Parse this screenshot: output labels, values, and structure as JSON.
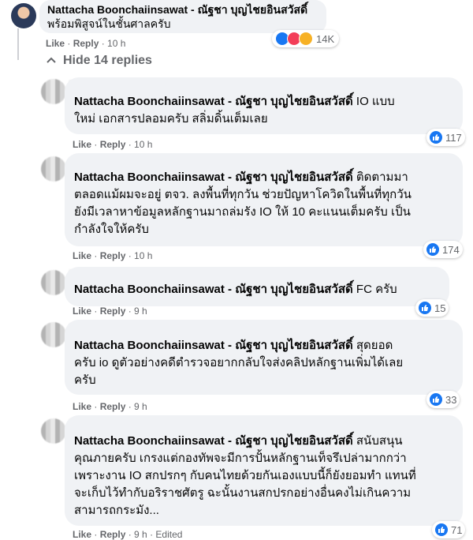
{
  "top_comment": {
    "author": "Nattacha Boonchaiinsawat - ณัฐชา บุญไชยอินสวัสดิ์",
    "text": "พร้อมพิสูจน์ในชั้นศาลครับ",
    "like_label": "Like",
    "reply_label": "Reply",
    "time": "10 h",
    "reactions": {
      "icons": [
        "like-icon",
        "heart-icon",
        "haha-icon"
      ],
      "count": "14K"
    }
  },
  "hide_replies_label": "Hide 14 replies",
  "replies": [
    {
      "author": "Nattacha Boonchaiinsawat - ณัฐชา บุญไชยอินสวัสดิ์",
      "lines": [
        "IO แบบ",
        "ใหม่ เอกสารปลอมครับ สลิ่มดิ้นเต็มเลย"
      ],
      "like_label": "Like",
      "reply_label": "Reply",
      "time": "10 h",
      "reaction_count": "117"
    },
    {
      "author": "Nattacha Boonchaiinsawat - ณัฐชา บุญไชยอินสวัสดิ์",
      "lines": [
        "ติดตามมา",
        "ตลอดแม้ผมจะอยู่ ตจว. ลงพื้นที่ทุกวัน ช่วยปัญหาโควิดในพื้นที่ทุกวัน",
        "ยังมีเวลาหาข้อมูลหลักฐานมาถล่มรัง IO ให้ 10 คะแนนเต็มครับ เป็น",
        "กำลังใจให้ครับ"
      ],
      "like_label": "Like",
      "reply_label": "Reply",
      "time": "10 h",
      "reaction_count": "174"
    },
    {
      "author": "Nattacha Boonchaiinsawat - ณัฐชา บุญไชยอินสวัสดิ์",
      "lines": [
        "FC ครับ"
      ],
      "like_label": "Like",
      "reply_label": "Reply",
      "time": "9 h",
      "reaction_count": "15"
    },
    {
      "author": "Nattacha Boonchaiinsawat - ณัฐชา บุญไชยอินสวัสดิ์",
      "lines": [
        "สุดยอด",
        "ครับ io ดูตัวอย่างคดีตำรวจอยากกลับใจส่งคลิปหลักฐานเพิ่มได้เลย",
        "ครับ"
      ],
      "like_label": "Like",
      "reply_label": "Reply",
      "time": "9 h",
      "reaction_count": "33"
    },
    {
      "author": "Nattacha Boonchaiinsawat - ณัฐชา บุญไชยอินสวัสดิ์",
      "lines": [
        "สนับสนุน",
        "คุณภายครับ เกรงแต่กองทัพจะมีการปั้นหลักฐานเท็จรึเปล่ามากกว่า",
        "เพราะงาน IO สกปรกๆ กับคนไทยด้วยกันเองแบบนี้ก็ยังยอมทำ แทนที่",
        "จะเก็บไว้ทำกับอริราชศัตรู ฉะนั้นงานสกปรกอย่างอื่นคงไม่เกินความ",
        "สามารถกระมัง..."
      ],
      "like_label": "Like",
      "reply_label": "Reply",
      "time": "9 h",
      "edited": "Edited",
      "reaction_count": "71"
    }
  ],
  "colors": {
    "bubble": "#f0f2f5",
    "meta": "#65676b",
    "like_blue": "#1877f2",
    "thread": "#ced0d4"
  }
}
